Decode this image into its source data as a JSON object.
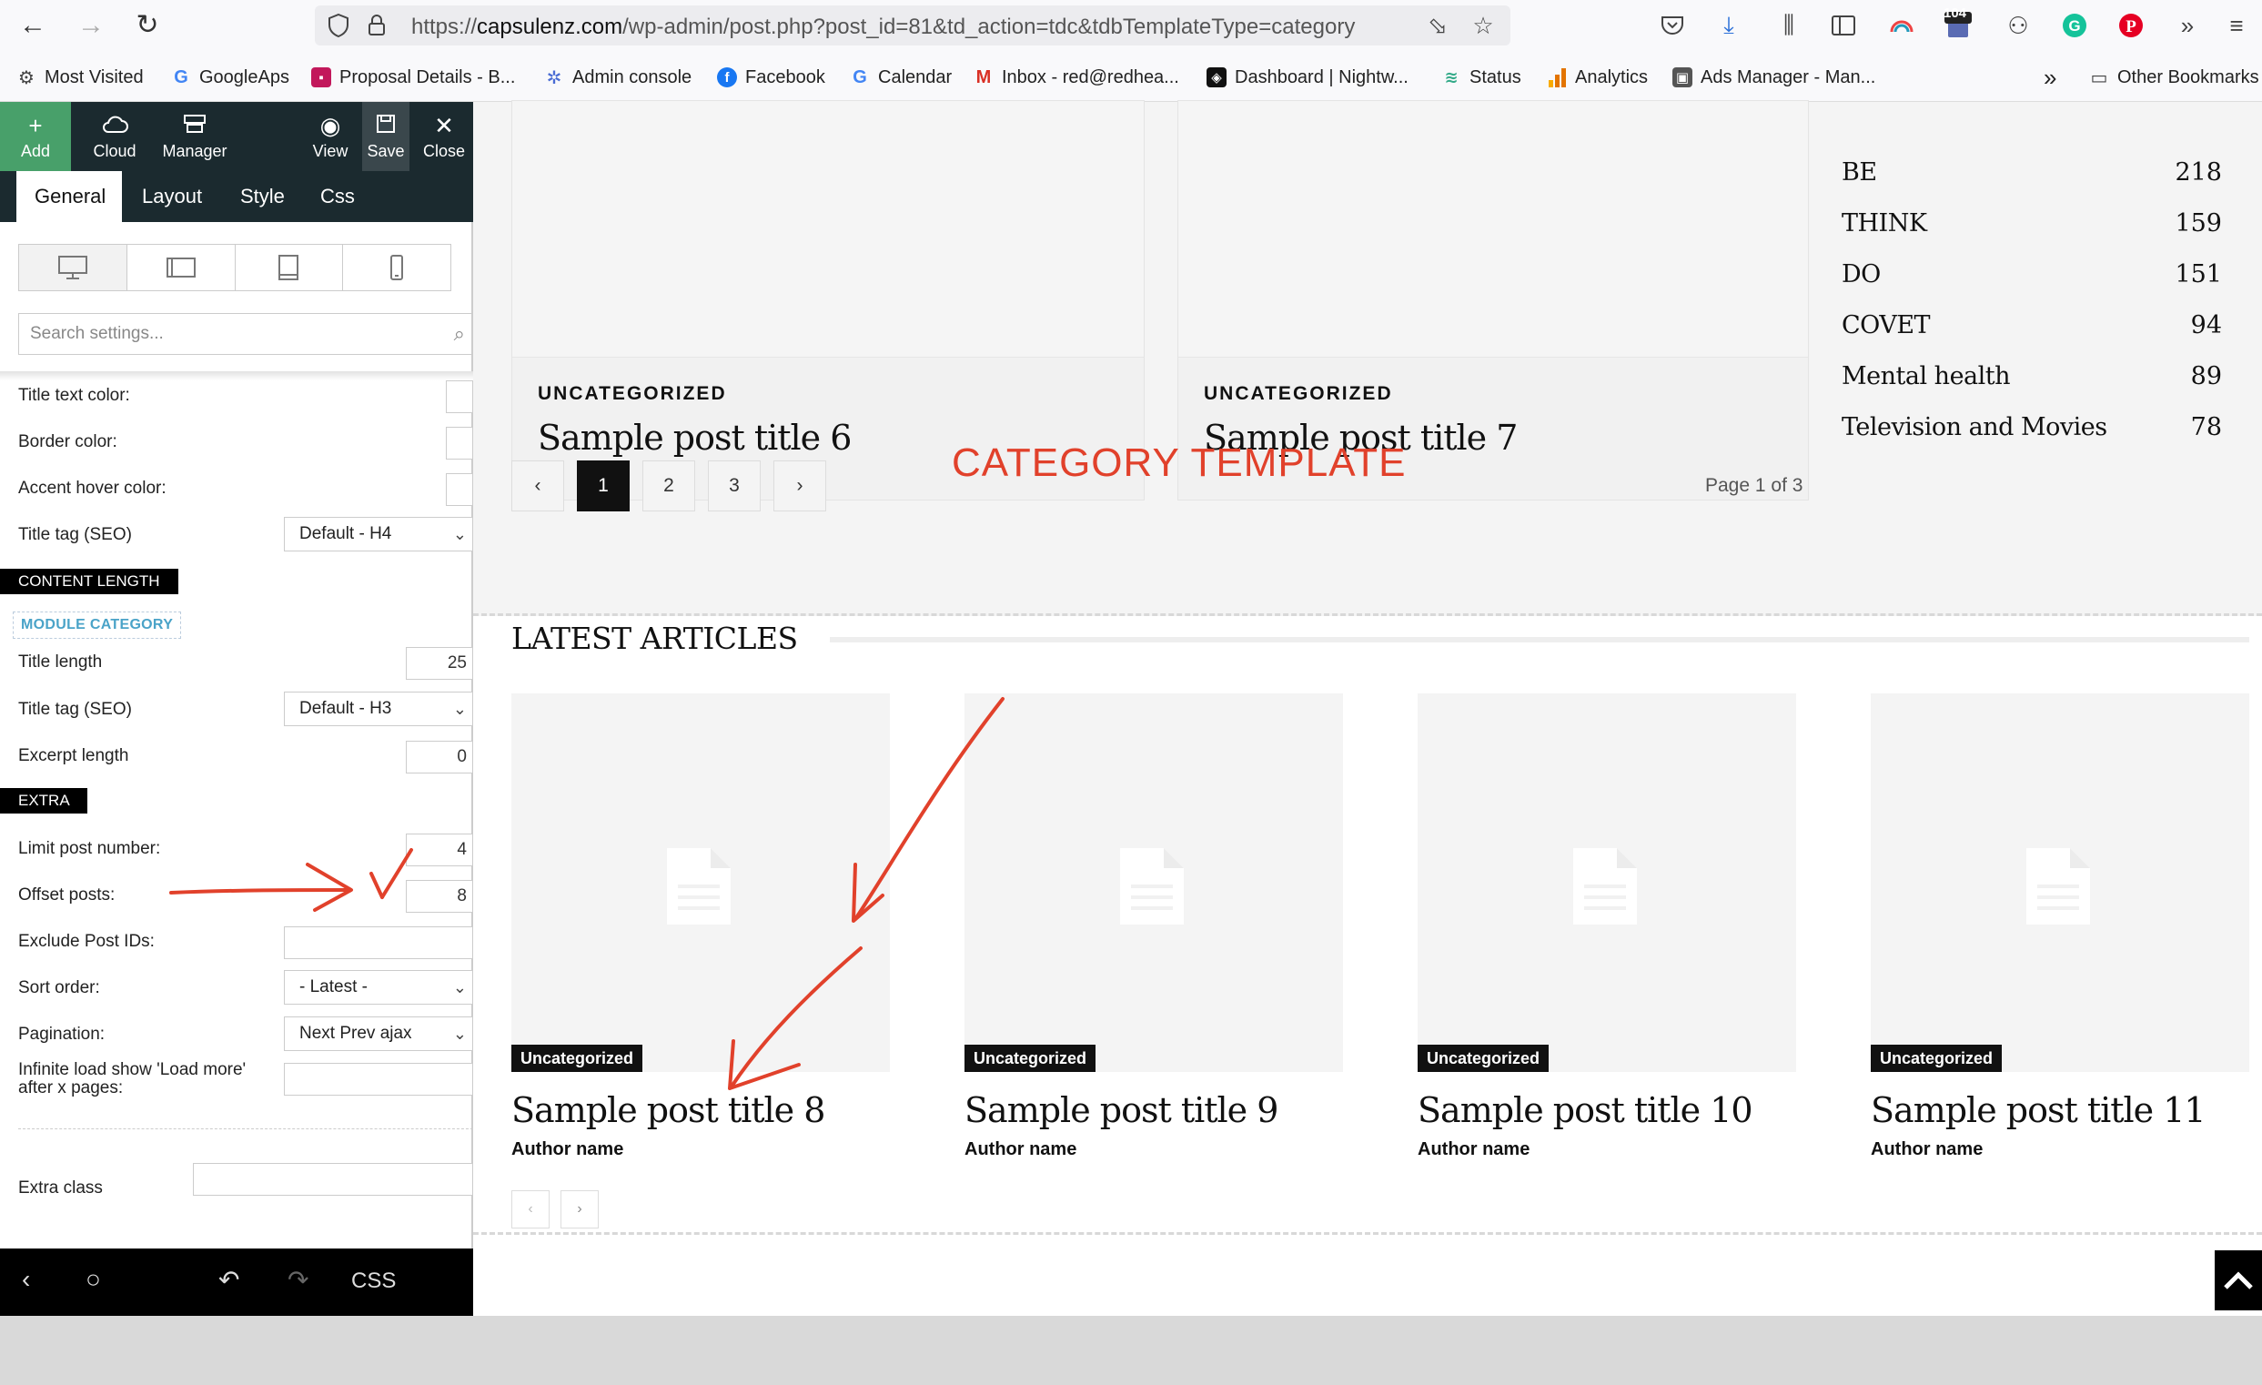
{
  "browser": {
    "url_prefix": "https://",
    "url_host": "capsulenz.com",
    "url_path": "/wp-admin/post.php?post_id=81&td_action=tdc&tdbTemplateType=category",
    "badge_count": "104",
    "bookmarks": [
      {
        "label": "Most Visited",
        "icon": "gear-icon"
      },
      {
        "label": "GoogleAps",
        "icon": "google-icon"
      },
      {
        "label": "Proposal Details - B...",
        "icon": "proposal-icon"
      },
      {
        "label": "Admin console",
        "icon": "admin-icon"
      },
      {
        "label": "Facebook",
        "icon": "facebook-icon"
      },
      {
        "label": "Calendar",
        "icon": "google-icon"
      },
      {
        "label": "Inbox - red@redhea...",
        "icon": "gmail-icon"
      },
      {
        "label": "Dashboard | Nightw...",
        "icon": "dashboard-icon"
      },
      {
        "label": "Status",
        "icon": "status-icon"
      },
      {
        "label": "Analytics",
        "icon": "analytics-icon"
      },
      {
        "label": "Ads Manager - Man...",
        "icon": "ads-icon"
      }
    ],
    "other_bookmarks": "Other Bookmarks"
  },
  "panel": {
    "toolbar": {
      "add": "Add",
      "cloud": "Cloud",
      "manager": "Manager",
      "view": "View",
      "save": "Save",
      "close": "Close"
    },
    "tabs": [
      "General",
      "Layout",
      "Style",
      "Css"
    ],
    "search_placeholder": "Search settings...",
    "fields": {
      "title_text_color": "Title text color:",
      "border_color": "Border color:",
      "accent_hover_color": "Accent hover color:",
      "title_tag_1": "Title tag (SEO)",
      "title_tag_1_value": "Default - H4",
      "content_length": "CONTENT LENGTH",
      "module_category": "MODULE CATEGORY",
      "title_length": "Title length",
      "title_length_value": "25",
      "title_tag_2": "Title tag (SEO)",
      "title_tag_2_value": "Default - H3",
      "excerpt_length": "Excerpt length",
      "excerpt_length_value": "0",
      "extra": "EXTRA",
      "limit_post_number": "Limit post number:",
      "limit_post_number_value": "4",
      "offset_posts": "Offset posts:",
      "offset_posts_value": "8",
      "exclude_post_ids": "Exclude Post IDs:",
      "sort_order": "Sort order:",
      "sort_order_value": "- Latest -",
      "pagination": "Pagination:",
      "pagination_value": "Next Prev ajax",
      "infinite_load": "Infinite load show 'Load more' after x pages:",
      "extra_class": "Extra class"
    },
    "bottom_css": "CSS"
  },
  "canvas": {
    "top_cards": [
      {
        "category": "UNCATEGORIZED",
        "title": "Sample post title 6"
      },
      {
        "category": "UNCATEGORIZED",
        "title": "Sample post title 7"
      }
    ],
    "categories": [
      {
        "name": "BE",
        "count": "218"
      },
      {
        "name": "THINK",
        "count": "159"
      },
      {
        "name": "DO",
        "count": "151"
      },
      {
        "name": "COVET",
        "count": "94"
      },
      {
        "name": "Mental health",
        "count": "89"
      },
      {
        "name": "Television and Movies",
        "count": "78"
      }
    ],
    "pagination": {
      "prev": "‹",
      "pages": [
        "1",
        "2",
        "3"
      ],
      "next": "›",
      "summary": "Page 1 of 3"
    },
    "template_label": "CATEGORY TEMPLATE",
    "latest_heading": "LATEST ARTICLES",
    "articles": [
      {
        "badge": "Uncategorized",
        "title": "Sample post title 8",
        "author": "Author name"
      },
      {
        "badge": "Uncategorized",
        "title": "Sample post title 9",
        "author": "Author name"
      },
      {
        "badge": "Uncategorized",
        "title": "Sample post title 10",
        "author": "Author name"
      },
      {
        "badge": "Uncategorized",
        "title": "Sample post title 11",
        "author": "Author name"
      }
    ]
  },
  "colors": {
    "accent_red": "#e1412b",
    "panel_dark": "#1b2a2f",
    "add_green": "#48a06a"
  }
}
